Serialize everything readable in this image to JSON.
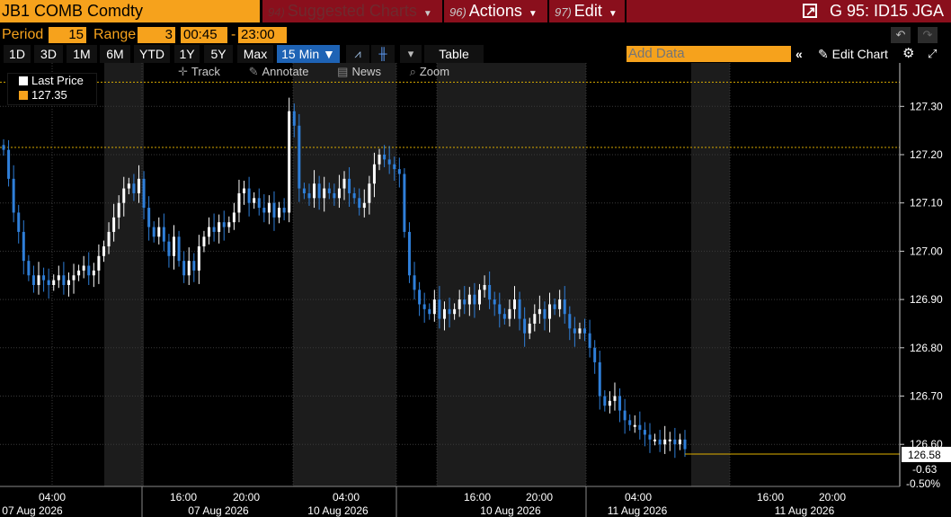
{
  "header": {
    "ticker": "JB1 COMB Comdty",
    "suggested": {
      "num": "94)",
      "label": "Suggested Charts"
    },
    "actions": {
      "num": "96)",
      "label": "Actions"
    },
    "edit": {
      "num": "97)",
      "label": "Edit"
    },
    "launch": "G 95: ID15 JGA"
  },
  "controls": {
    "period_label": "Period",
    "period_value": "15",
    "range_label": "Range",
    "range_value": "3",
    "start_time": "00:45",
    "range_dash": "-",
    "end_time": "23:00",
    "timeframes": [
      "1D",
      "3D",
      "1M",
      "6M",
      "YTD",
      "1Y",
      "5Y",
      "Max"
    ],
    "interval": "15 Min",
    "table_label": "Table",
    "add_data_placeholder": "Add Data",
    "edit_chart": "Edit Chart"
  },
  "chart_tools": {
    "track": "Track",
    "annotate": "Annotate",
    "news": "News",
    "zoom": "Zoom"
  },
  "legend": {
    "series_name": "Last Price",
    "last_value": "127.35",
    "series_color": "#ffffff",
    "value_color": "#f6a21c"
  },
  "colors": {
    "up": "#ffffff",
    "down": "#2f7fd9",
    "accent": "#f6a21c",
    "menu": "#8a0f1c",
    "shade": "#1c1c1c",
    "dotted": "#e0b000"
  },
  "chart_data": {
    "type": "candlestick",
    "y_ticks": [
      127.3,
      127.2,
      127.1,
      127.0,
      126.9,
      126.8,
      126.7,
      126.6
    ],
    "y_tick_labels": [
      "127.30",
      "127.20",
      "127.10",
      "127.00",
      "126.90",
      "126.80",
      "126.70",
      "126.60"
    ],
    "ylim": [
      126.55,
      127.37
    ],
    "dotted_levels": [
      127.35,
      127.215
    ],
    "last_price_label": "126.58",
    "change_label": "-0.63",
    "change_pct_label": "-0.50%",
    "last_price": 126.58,
    "time_labels": [
      "04:00",
      "16:00",
      "20:00",
      "04:00",
      "16:00",
      "20:00",
      "04:00",
      "16:00",
      "20:00"
    ],
    "date_labels": [
      "07 Aug 2026",
      "07 Aug 2026",
      "10 Aug 2026",
      "10 Aug 2026",
      "11 Aug 2026",
      "11 Aug 2026"
    ],
    "closes": [
      127.21,
      127.15,
      127.08,
      127.04,
      126.98,
      126.95,
      126.93,
      126.95,
      126.94,
      126.93,
      126.94,
      126.95,
      126.93,
      126.94,
      126.95,
      126.96,
      126.97,
      126.95,
      126.96,
      126.99,
      127.01,
      127.04,
      127.07,
      127.1,
      127.13,
      127.14,
      127.12,
      127.15,
      127.09,
      127.05,
      127.03,
      127.05,
      127.02,
      126.99,
      127.03,
      126.98,
      126.95,
      126.98,
      126.96,
      127.01,
      127.03,
      127.05,
      127.04,
      127.06,
      127.05,
      127.06,
      127.08,
      127.12,
      127.13,
      127.1,
      127.11,
      127.09,
      127.08,
      127.1,
      127.07,
      127.09,
      127.08,
      127.29,
      127.26,
      127.13,
      127.12,
      127.11,
      127.14,
      127.11,
      127.13,
      127.12,
      127.11,
      127.13,
      127.15,
      127.12,
      127.11,
      127.09,
      127.1,
      127.14,
      127.18,
      127.2,
      127.19,
      127.18,
      127.17,
      127.16,
      127.04,
      126.95,
      126.92,
      126.89,
      126.88,
      126.87,
      126.9,
      126.86,
      126.88,
      126.87,
      126.88,
      126.9,
      126.89,
      126.91,
      126.89,
      126.92,
      126.93,
      126.9,
      126.89,
      126.87,
      126.86,
      126.88,
      126.9,
      126.86,
      126.83,
      126.85,
      126.87,
      126.88,
      126.86,
      126.89,
      126.88,
      126.9,
      126.87,
      126.84,
      126.83,
      126.84,
      126.83,
      126.8,
      126.77,
      126.7,
      126.68,
      126.69,
      126.7,
      126.67,
      126.65,
      126.64,
      126.64,
      126.63,
      126.62,
      126.61,
      126.61,
      126.6,
      126.61,
      126.61,
      126.6,
      126.61,
      126.59
    ]
  }
}
